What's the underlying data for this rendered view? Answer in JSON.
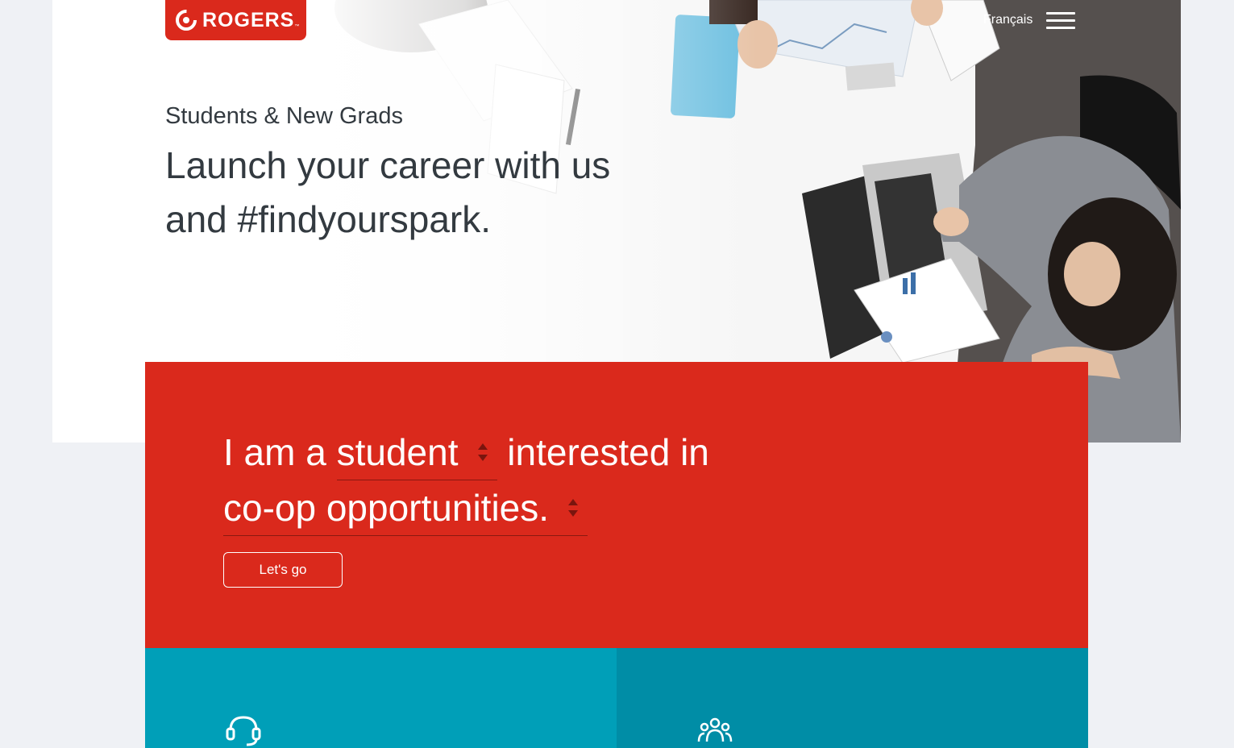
{
  "brand": {
    "name": "ROGERS",
    "trademark": "™",
    "color": "#da291c"
  },
  "header": {
    "language_link": "Français",
    "menu_icon": "hamburger-menu-icon"
  },
  "hero": {
    "eyebrow": "Students & New Grads",
    "headline": "Launch your career with us and #findyourspark."
  },
  "selector": {
    "prefix": "I am a",
    "role_value": "student",
    "middle": "interested in",
    "interest_value": "co-op opportunities.",
    "button_label": "Let's go",
    "panel_color": "#da291c"
  },
  "cards": [
    {
      "icon": "headset-icon",
      "color": "#009fb8"
    },
    {
      "icon": "people-group-icon",
      "color": "#008da6"
    }
  ]
}
